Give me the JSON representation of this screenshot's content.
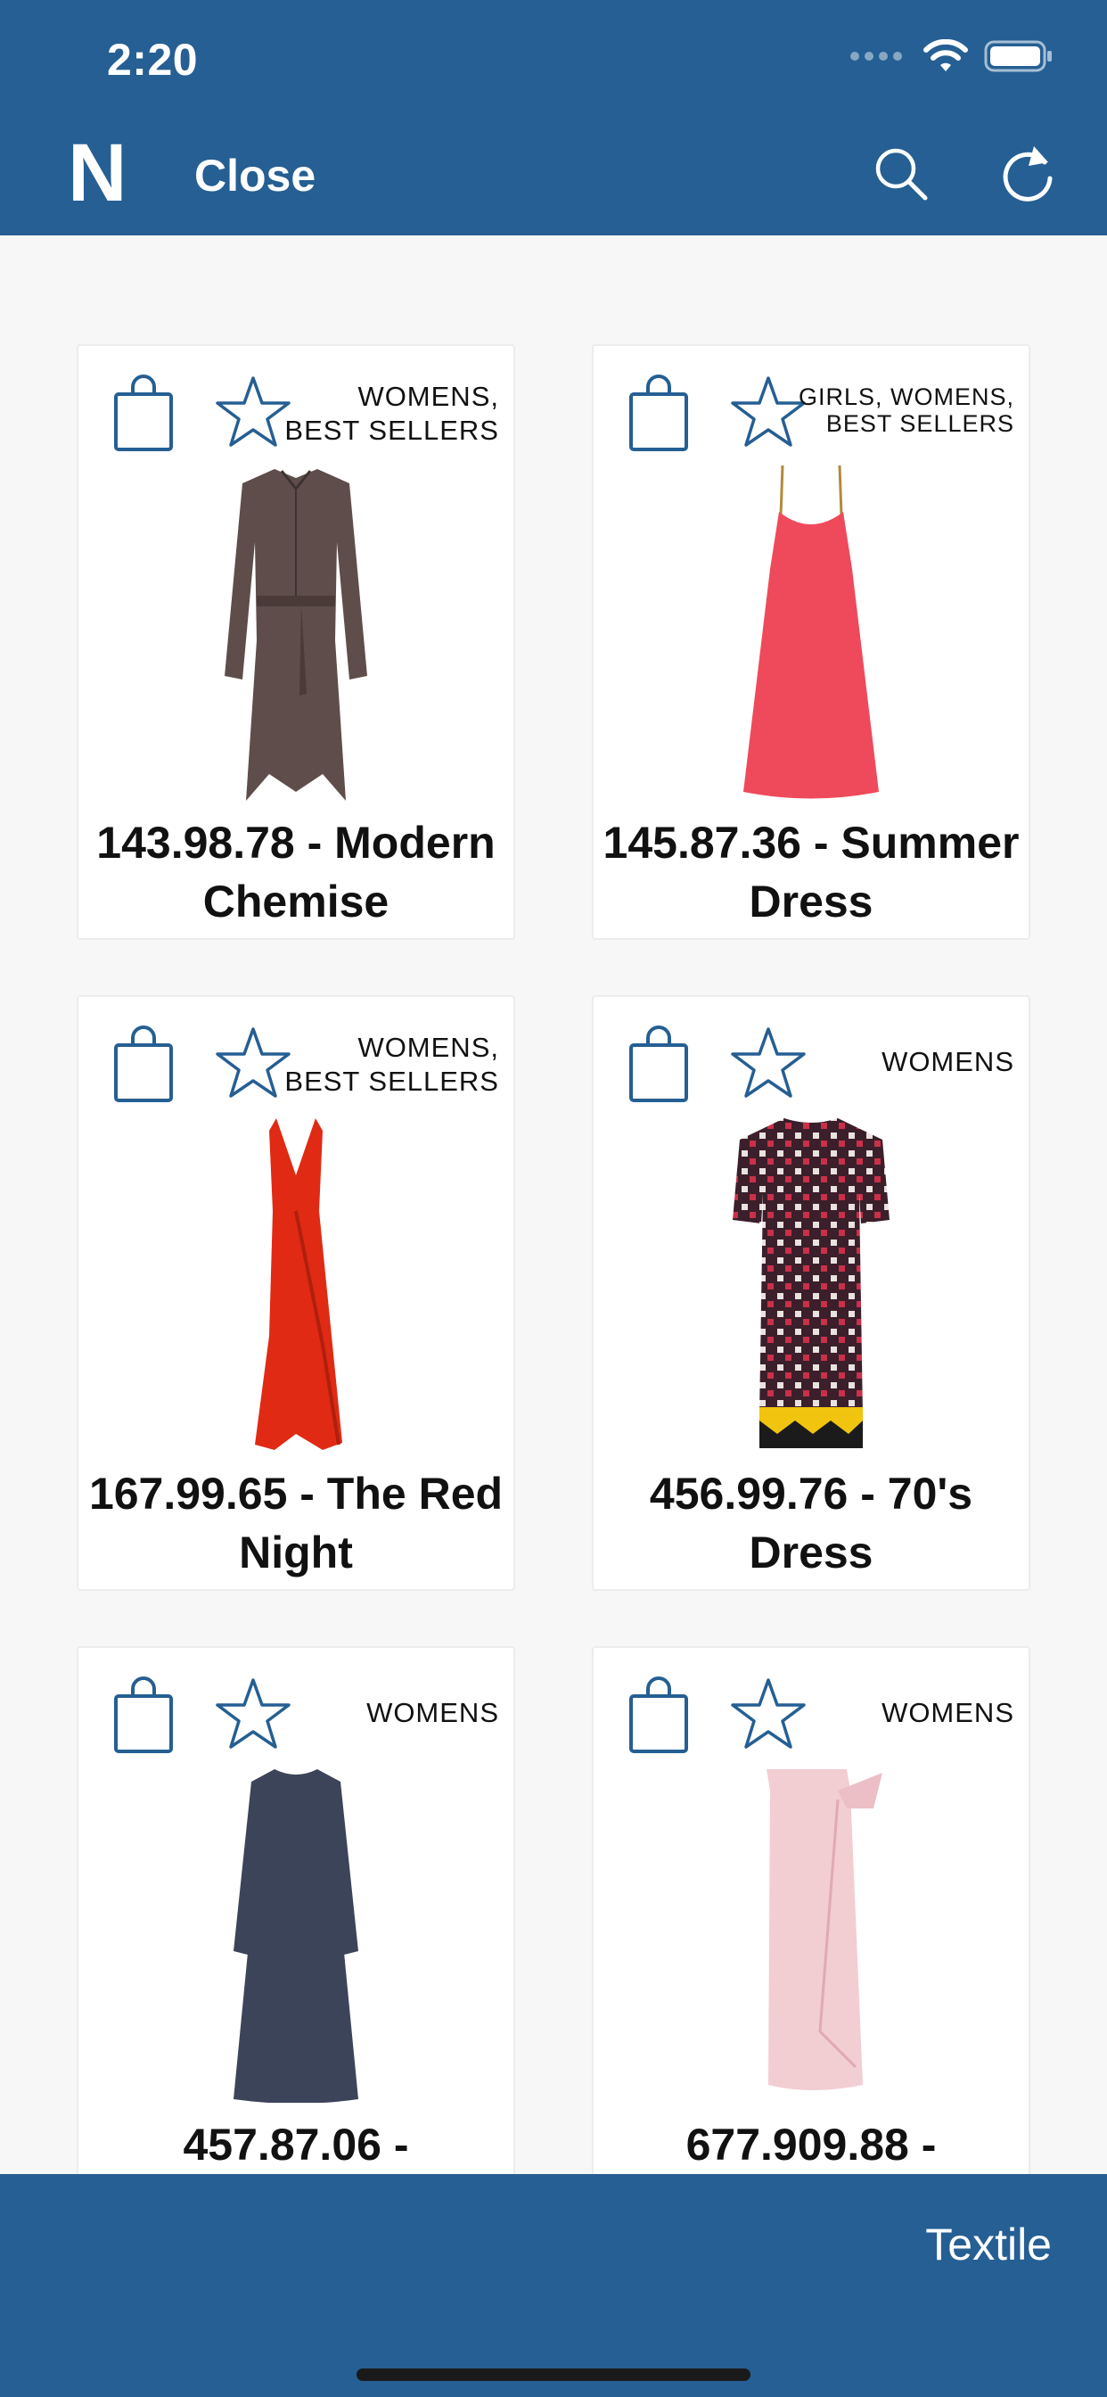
{
  "status_bar": {
    "time": "2:20"
  },
  "header": {
    "logo": "N",
    "close_label": "Close",
    "icons": [
      "search-icon",
      "refresh-icon"
    ]
  },
  "products": [
    {
      "tags": "WOMENS, BEST SELLERS",
      "title": "143.98.78 - Modern Chemise",
      "image": "brown-shirt-dress"
    },
    {
      "tags": "GIRLS, WOMENS, BEST SELLERS",
      "title": "145.87.36 - Summer Dress",
      "image": "coral-slip-dress"
    },
    {
      "tags": "WOMENS, BEST SELLERS",
      "title": "167.99.65 - The Red Night",
      "image": "red-gown"
    },
    {
      "tags": "WOMENS",
      "title": "456.99.76 - 70's Dress",
      "image": "patterned-dress"
    },
    {
      "tags": "WOMENS",
      "title": "457.87.06 -",
      "image": "navy-long-dress"
    },
    {
      "tags": "WOMENS",
      "title": "677.909.88 -",
      "image": "pink-wrap-skirt"
    }
  ],
  "bottom_bar": {
    "label": "Textile"
  },
  "colors": {
    "brand": "#255f93",
    "icon_stroke": "#255f93",
    "background": "#f7f7f7"
  }
}
